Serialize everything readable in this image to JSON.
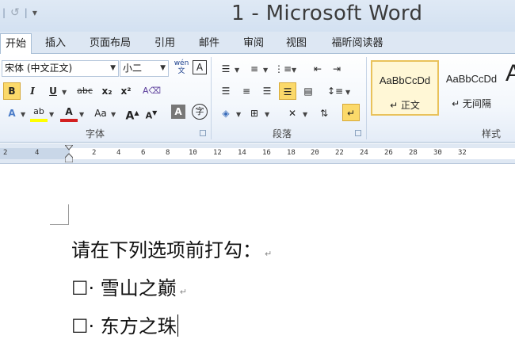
{
  "window": {
    "title": "1 - Microsoft Word",
    "qat": {
      "redo_glyph": "↺",
      "more_glyph": "▾",
      "sep": "|"
    }
  },
  "tabs": [
    "开始",
    "插入",
    "页面布局",
    "引用",
    "邮件",
    "审阅",
    "视图",
    "福昕阅读器"
  ],
  "ribbon": {
    "font_group": {
      "label": "字体",
      "font_name": "宋体 (中文正文)",
      "font_size": "小二",
      "btn_bold": "B",
      "btn_italic": "I",
      "btn_underline": "U",
      "btn_strike": "abc",
      "btn_sub": "x₂",
      "btn_sup": "x²",
      "btn_grow": "A",
      "btn_shrink": "A",
      "btn_case": "Aa",
      "btn_font_color": "A",
      "btn_phonetic": "wén",
      "btn_border": "A",
      "btn_circle": "字",
      "btn_clear": "A",
      "btn_effects": "A",
      "btn_highlight": "ab"
    },
    "paragraph_group": {
      "label": "段落"
    },
    "styles_group": {
      "label": "样式",
      "styles": [
        {
          "sample": "AaBbCcDd",
          "name": "↵ 正文",
          "selected": true
        },
        {
          "sample": "AaBbCcDd",
          "name": "↵ 无间隔",
          "selected": false
        }
      ],
      "overflow_glyph": "A"
    }
  },
  "ruler": {
    "ticks": [
      "2",
      "4",
      "6",
      "8",
      "10",
      "12",
      "14",
      "16",
      "18",
      "20",
      "22",
      "24",
      "26",
      "28",
      "30",
      "32"
    ]
  },
  "document": {
    "lines": [
      {
        "text": "请在下列选项前打勾：",
        "mark": "↵"
      },
      {
        "text": "☐· 雪山之巅",
        "mark": "↵"
      },
      {
        "text": "☐· 东方之珠",
        "mark": ""
      }
    ]
  },
  "colors": {
    "accent_highlight": "#fbd96a",
    "ribbon_border": "#a9bfd6",
    "font_color_red": "#d32020",
    "highlight_yellow": "#ffff00"
  }
}
